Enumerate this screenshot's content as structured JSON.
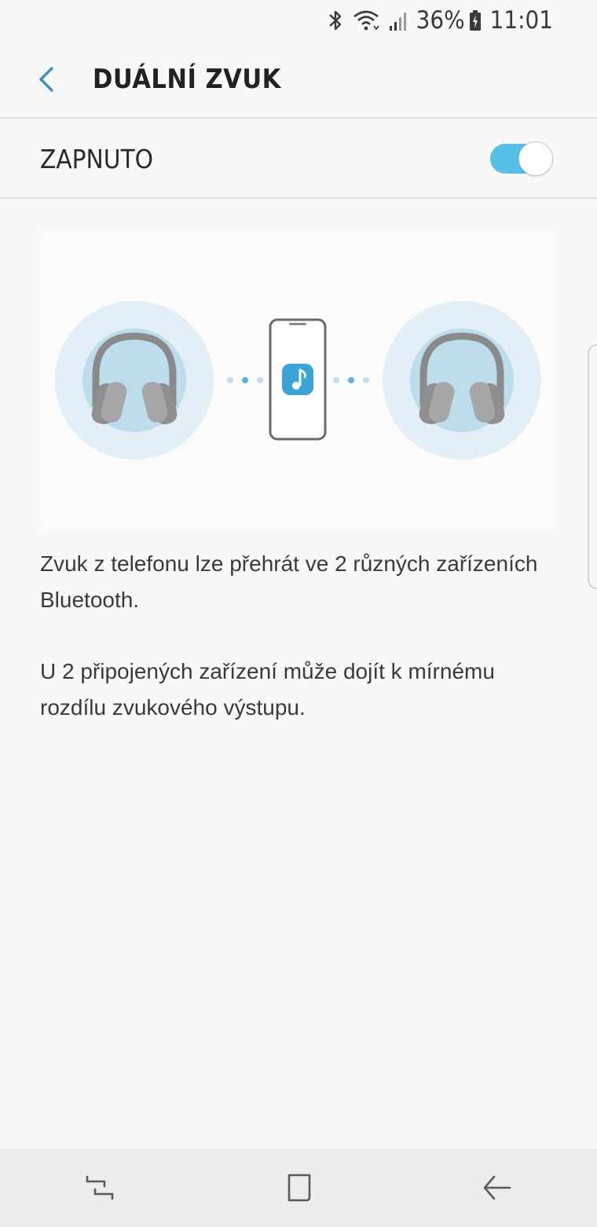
{
  "status_bar": {
    "battery_percent": "36%",
    "time": "11:01",
    "icons": [
      "bluetooth-icon",
      "wifi-icon",
      "signal-icon",
      "battery-charging-icon"
    ]
  },
  "app_bar": {
    "title": "DUÁLNÍ ZVUK",
    "back_icon": "chevron-left-icon"
  },
  "switch": {
    "label": "ZAPNUTO",
    "on": true,
    "accent_color": "#56c0e8"
  },
  "illustration": {
    "icons": [
      "headphones-icon",
      "phone-icon",
      "music-note-icon",
      "headphones-icon"
    ]
  },
  "description": {
    "paragraph1": "Zvuk z telefonu lze přehrát ve 2 různých zařízeních Bluetooth.",
    "paragraph2": "U 2 připojených zařízení může dojít k mírnému rozdílu zvukového výstupu."
  },
  "nav_bar": {
    "icons": [
      "recent-apps-icon",
      "home-icon",
      "back-arrow-icon"
    ]
  }
}
